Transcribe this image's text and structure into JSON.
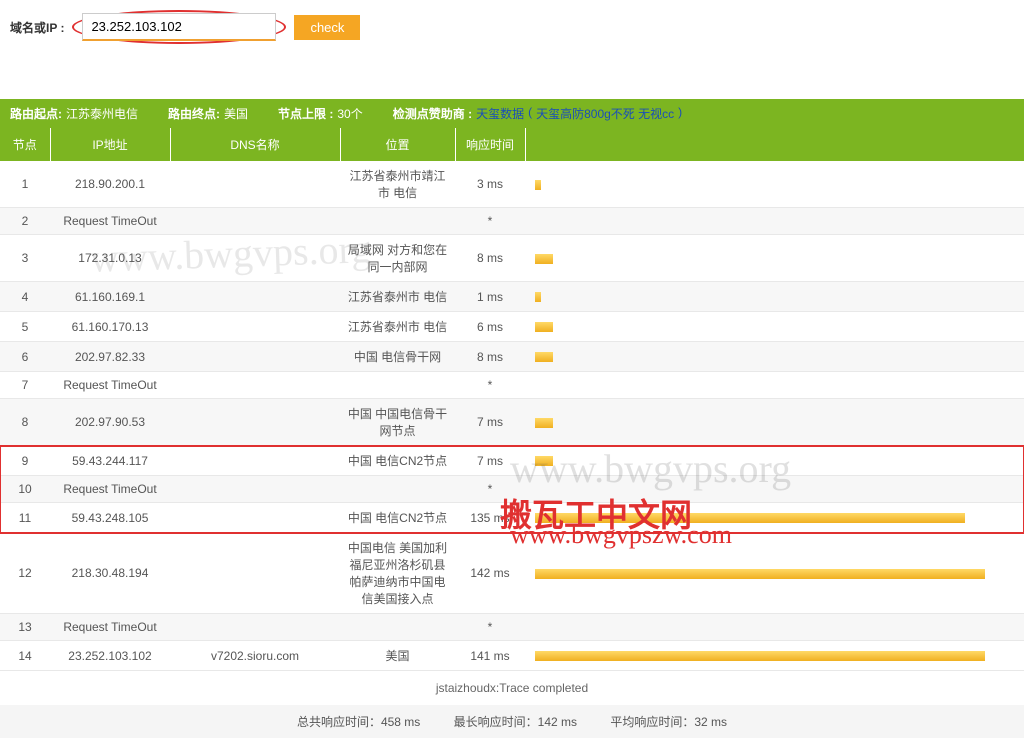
{
  "search": {
    "label": "域名或IP :",
    "value": "23.252.103.102",
    "button": "check"
  },
  "info": {
    "route_start_label": "路由起点:",
    "route_start_value": "江苏泰州电信",
    "route_end_label": "路由终点:",
    "route_end_value": "美国",
    "node_limit_label": "节点上限 :",
    "node_limit_value": "30个",
    "sponsor_label": "检测点赞助商 :",
    "sponsor_link1": "天玺数据",
    "sponsor_link2": "天玺高防800g不死 无视cc"
  },
  "headers": {
    "node": "节点",
    "ip": "IP地址",
    "dns": "DNS名称",
    "location": "位置",
    "time": "响应时间",
    "bar": ""
  },
  "rows": [
    {
      "node": "1",
      "ip": "218.90.200.1",
      "dns": "",
      "location": "江苏省泰州市靖江市 电信",
      "time": "3 ms",
      "bar": "tiny"
    },
    {
      "node": "2",
      "ip": "Request TimeOut",
      "dns": "",
      "location": "",
      "time": "*",
      "bar": ""
    },
    {
      "node": "3",
      "ip": "172.31.0.13",
      "dns": "",
      "location": "局域网 对方和您在同一内部网",
      "time": "8 ms",
      "bar": "small"
    },
    {
      "node": "4",
      "ip": "61.160.169.1",
      "dns": "",
      "location": "江苏省泰州市 电信",
      "time": "1 ms",
      "bar": "tiny"
    },
    {
      "node": "5",
      "ip": "61.160.170.13",
      "dns": "",
      "location": "江苏省泰州市 电信",
      "time": "6 ms",
      "bar": "small"
    },
    {
      "node": "6",
      "ip": "202.97.82.33",
      "dns": "",
      "location": "中国 电信骨干网",
      "time": "8 ms",
      "bar": "small"
    },
    {
      "node": "7",
      "ip": "Request TimeOut",
      "dns": "",
      "location": "",
      "time": "*",
      "bar": ""
    },
    {
      "node": "8",
      "ip": "202.97.90.53",
      "dns": "",
      "location": "中国 中国电信骨干网节点",
      "time": "7 ms",
      "bar": "small"
    },
    {
      "node": "9",
      "ip": "59.43.244.117",
      "dns": "",
      "location": "中国 电信CN2节点",
      "time": "7 ms",
      "bar": "small",
      "hl_start": true
    },
    {
      "node": "10",
      "ip": "Request TimeOut",
      "dns": "",
      "location": "",
      "time": "*",
      "bar": ""
    },
    {
      "node": "11",
      "ip": "59.43.248.105",
      "dns": "",
      "location": "中国 电信CN2节点",
      "time": "135 ms",
      "bar": "large",
      "hl_end": true
    },
    {
      "node": "12",
      "ip": "218.30.48.194",
      "dns": "",
      "location": "中国电信 美国加利福尼亚州洛杉矶县帕萨迪纳市中国电信美国接入点",
      "time": "142 ms",
      "bar": "max"
    },
    {
      "node": "13",
      "ip": "Request TimeOut",
      "dns": "",
      "location": "",
      "time": "*",
      "bar": ""
    },
    {
      "node": "14",
      "ip": "23.252.103.102",
      "dns": "v7202.sioru.com",
      "location": "美国",
      "time": "141 ms",
      "bar": "max"
    }
  ],
  "status": "jstaizhoudx:Trace completed",
  "summary": {
    "total": "总共响应时间：458 ms",
    "max": "最长响应时间：142 ms",
    "avg": "平均响应时间：32 ms"
  },
  "watermarks": {
    "w1": "www.bwgvps.org",
    "w2": "www.bwgvps.org",
    "w3": "搬瓦工中文网",
    "w4": "www.bwgvpszw.com"
  }
}
